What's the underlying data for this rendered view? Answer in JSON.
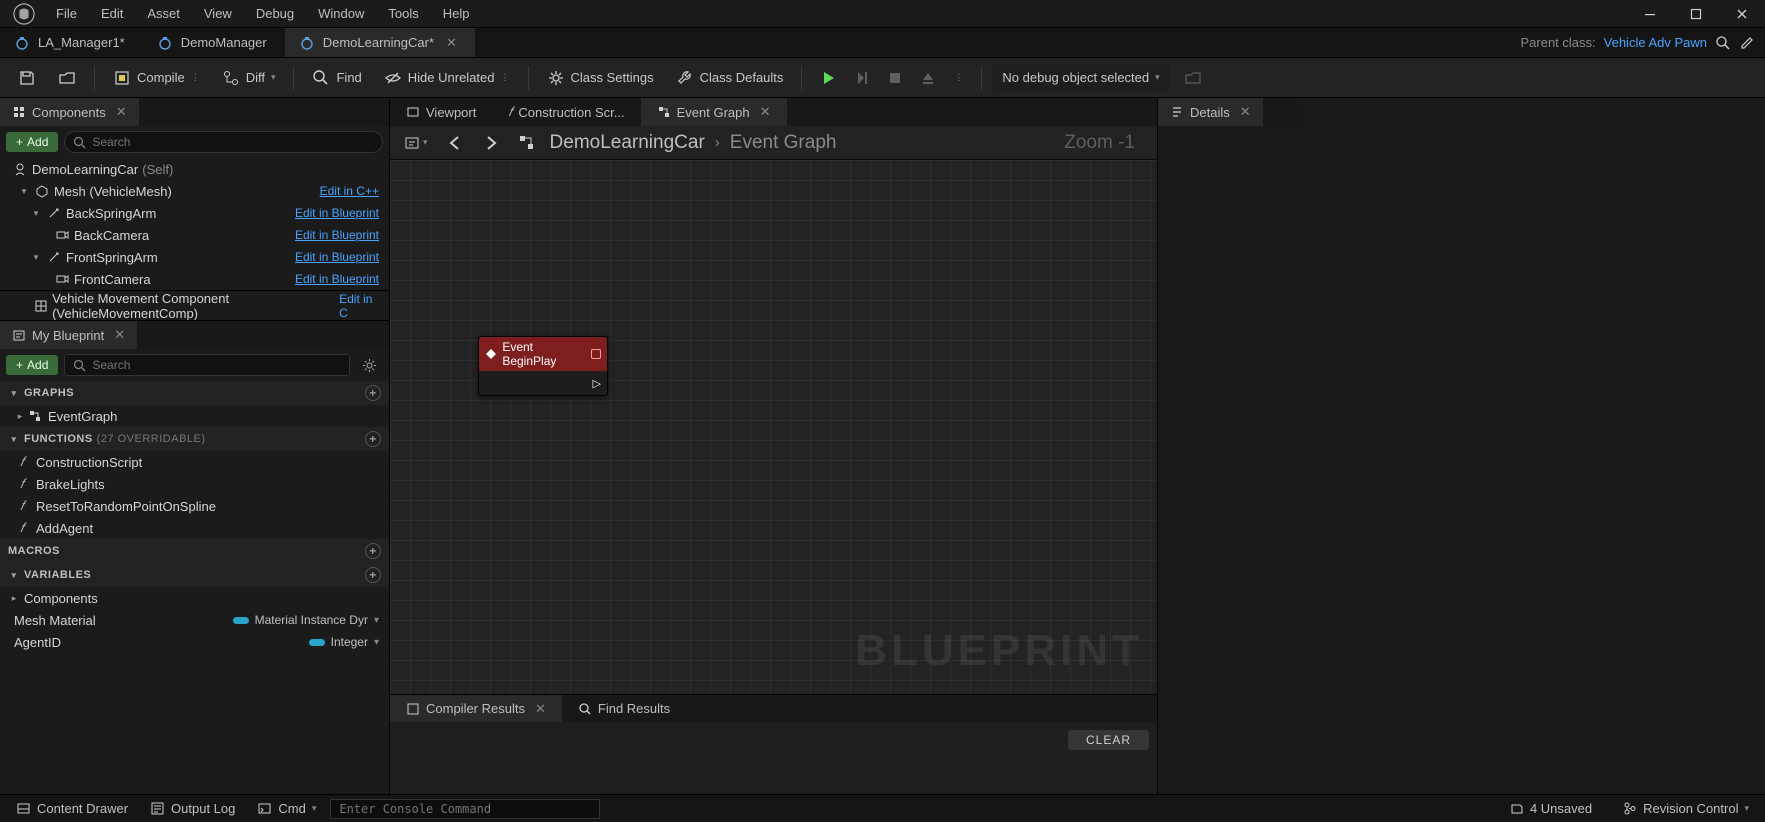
{
  "menu": [
    "File",
    "Edit",
    "Asset",
    "View",
    "Debug",
    "Window",
    "Tools",
    "Help"
  ],
  "asset_tabs": {
    "t0": "LA_Manager1*",
    "t1": "DemoManager",
    "t2": "DemoLearningCar*"
  },
  "parent_class_label": "Parent class:",
  "parent_class_value": "Vehicle Adv Pawn",
  "toolbar": {
    "compile": "Compile",
    "diff": "Diff",
    "find": "Find",
    "hide_unrelated": "Hide Unrelated",
    "class_settings": "Class Settings",
    "class_defaults": "Class Defaults",
    "debug_obj": "No debug object selected"
  },
  "panels": {
    "components": "Components",
    "details": "Details",
    "my_blueprint": "My Blueprint"
  },
  "add_label": "Add",
  "search_placeholder": "Search",
  "components_tree": {
    "root": {
      "name": "DemoLearningCar",
      "suffix": "(Self)"
    },
    "mesh": {
      "name": "Mesh (VehicleMesh)",
      "edit": "Edit in C++"
    },
    "back_spring": {
      "name": "BackSpringArm",
      "edit": "Edit in Blueprint"
    },
    "back_cam": {
      "name": "BackCamera",
      "edit": "Edit in Blueprint"
    },
    "front_spring": {
      "name": "FrontSpringArm",
      "edit": "Edit in Blueprint"
    },
    "front_cam": {
      "name": "FrontCamera",
      "edit": "Edit in Blueprint"
    },
    "vmove": {
      "name": "Vehicle Movement Component (VehicleMovementComp)",
      "edit": "Edit in C"
    }
  },
  "graph_tabs": {
    "viewport": "Viewport",
    "construction": "Construction Scr...",
    "event_graph": "Event Graph"
  },
  "breadcrumb": {
    "root": "DemoLearningCar",
    "leaf": "Event Graph"
  },
  "zoom": "Zoom -1",
  "watermark": "BLUEPRINT",
  "node": {
    "title": "Event BeginPlay"
  },
  "bottom_tabs": {
    "compiler": "Compiler Results",
    "find": "Find Results"
  },
  "clear": "CLEAR",
  "mybp": {
    "sections": {
      "graphs": "GRAPHS",
      "functions": "FUNCTIONS",
      "functions_dim": "(27 OVERRIDABLE)",
      "macros": "MACROS",
      "variables": "VARIABLES"
    },
    "graph_items": {
      "g0": "EventGraph"
    },
    "func_items": {
      "f0": "ConstructionScript",
      "f1": "BrakeLights",
      "f2": "ResetToRandomPointOnSpline",
      "f3": "AddAgent"
    },
    "var_sub": "Components",
    "vars": {
      "v0": {
        "name": "Mesh Material",
        "type": "Material Instance Dyr"
      },
      "v1": {
        "name": "AgentID",
        "type": "Integer"
      }
    }
  },
  "status": {
    "content_drawer": "Content Drawer",
    "output_log": "Output Log",
    "cmd": "Cmd",
    "cmd_placeholder": "Enter Console Command",
    "unsaved": "4 Unsaved",
    "revision": "Revision Control"
  }
}
